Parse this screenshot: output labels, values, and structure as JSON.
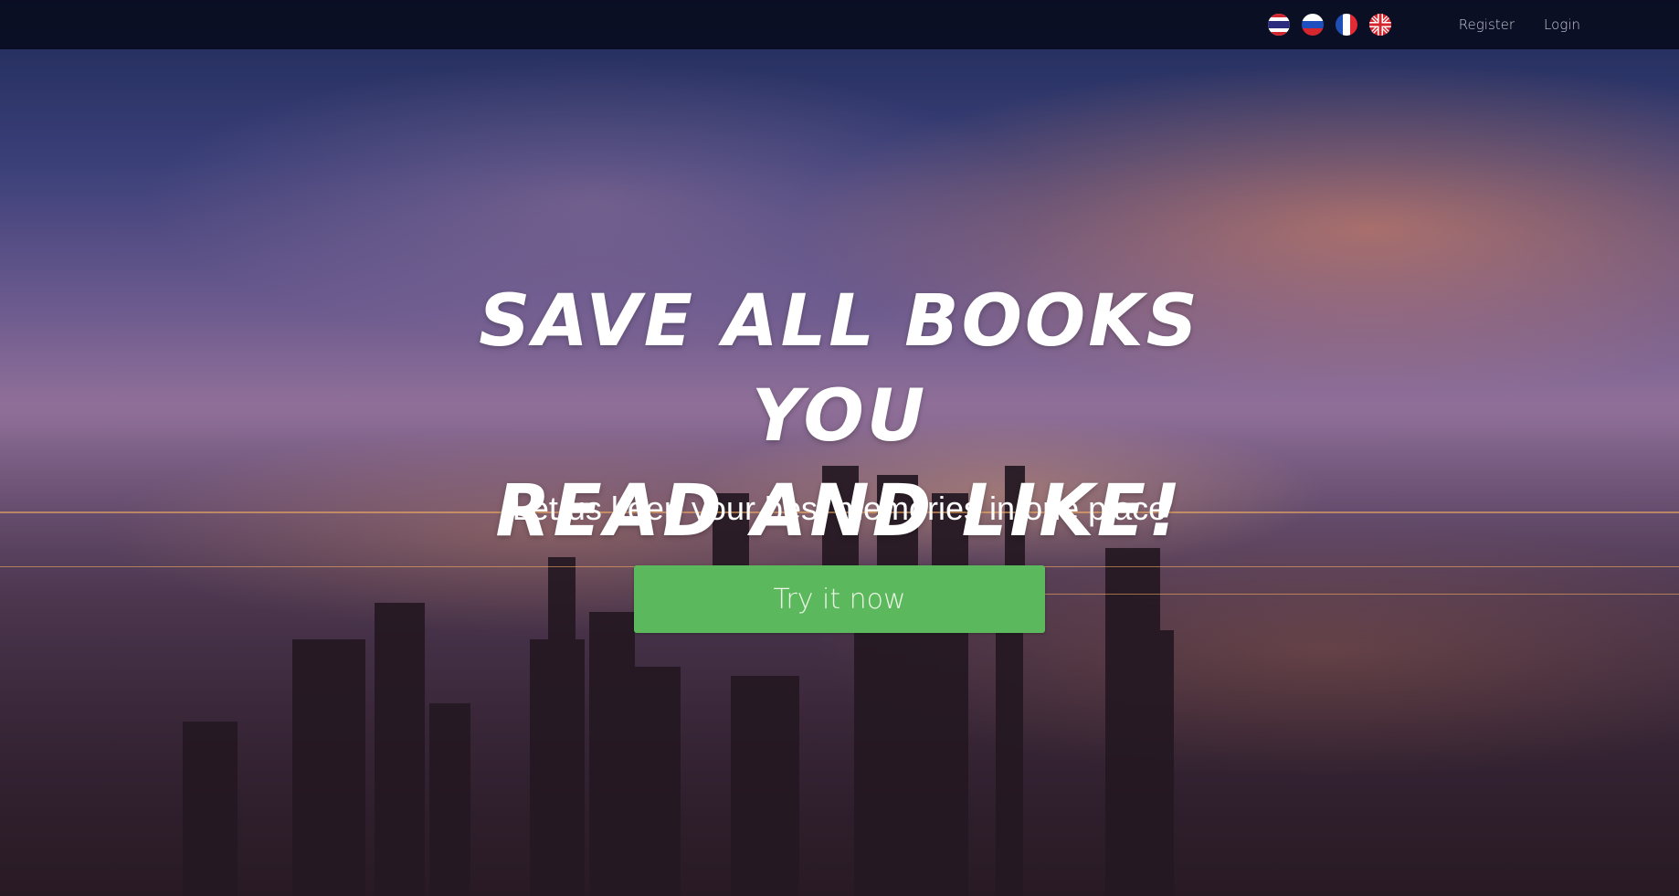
{
  "nav": {
    "languages": [
      {
        "code": "th",
        "icon": "thailand-flag-icon"
      },
      {
        "code": "ru",
        "icon": "russia-flag-icon"
      },
      {
        "code": "fr",
        "icon": "france-flag-icon"
      },
      {
        "code": "en",
        "icon": "uk-flag-icon"
      }
    ],
    "register_label": "Register",
    "login_label": "Login"
  },
  "hero": {
    "headline_line1": "SAVE ALL BOOKS YOU",
    "headline_line2": "READ AND LIKE!",
    "subtitle": "Let us keep your best memories in one place",
    "cta_label": "Try it now"
  },
  "colors": {
    "cta_green": "#5cb85c",
    "navbar_bg": "#050819",
    "text_white": "#ffffff"
  }
}
